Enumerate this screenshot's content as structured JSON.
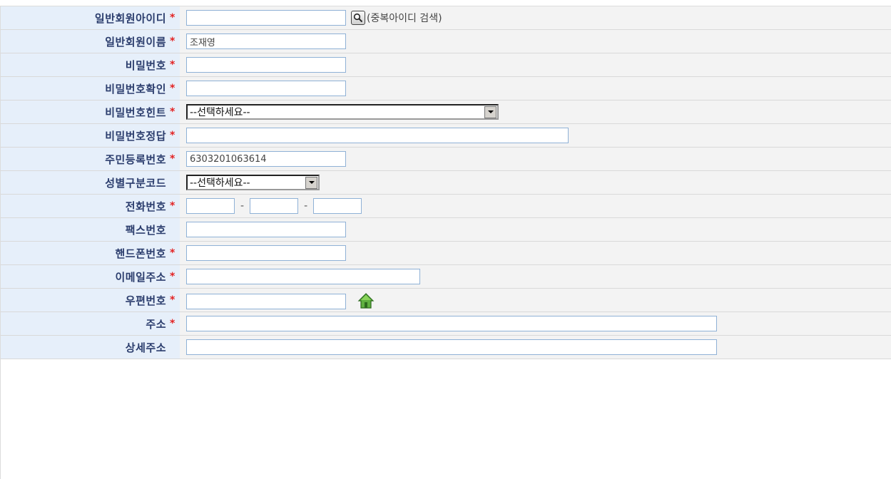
{
  "rows": [
    {
      "label": "일반회원아이디",
      "required": true
    },
    {
      "label": "일반회원이름",
      "required": true
    },
    {
      "label": "비밀번호",
      "required": true
    },
    {
      "label": "비밀번호확인",
      "required": true
    },
    {
      "label": "비밀번호힌트",
      "required": true
    },
    {
      "label": "비밀번호정답",
      "required": true
    },
    {
      "label": "주민등록번호",
      "required": true
    },
    {
      "label": "성별구분코드",
      "required": false
    },
    {
      "label": "전화번호",
      "required": true
    },
    {
      "label": "팩스번호",
      "required": false
    },
    {
      "label": "핸드폰번호",
      "required": true
    },
    {
      "label": "이메일주소",
      "required": true
    },
    {
      "label": "우편번호",
      "required": true
    },
    {
      "label": "주소",
      "required": true
    },
    {
      "label": "상세주소",
      "required": false
    }
  ],
  "required_mark": "*",
  "fields": {
    "member_id": "",
    "member_name": "조재영",
    "password": "",
    "password_confirm": "",
    "password_hint": "--선택하세요--",
    "password_answer": "",
    "resident_number": "6303201063614",
    "gender": "--선택하세요--",
    "phone": [
      "",
      "",
      ""
    ],
    "fax": "",
    "mobile": "",
    "email": "",
    "zipcode": "",
    "address": "",
    "address_detail": ""
  },
  "dup_check_text": "(중복아이디 검색)",
  "phone_separator": "-",
  "icons": {
    "search": "magnifier-icon",
    "home": "home-icon",
    "dropdown": "chevron-down-icon"
  },
  "colors": {
    "label_bg": "#e6effa",
    "label_text": "#2b3d6d",
    "required": "#e32222",
    "value_bg": "#f3f3f3",
    "input_border": "#8fb1d6"
  }
}
